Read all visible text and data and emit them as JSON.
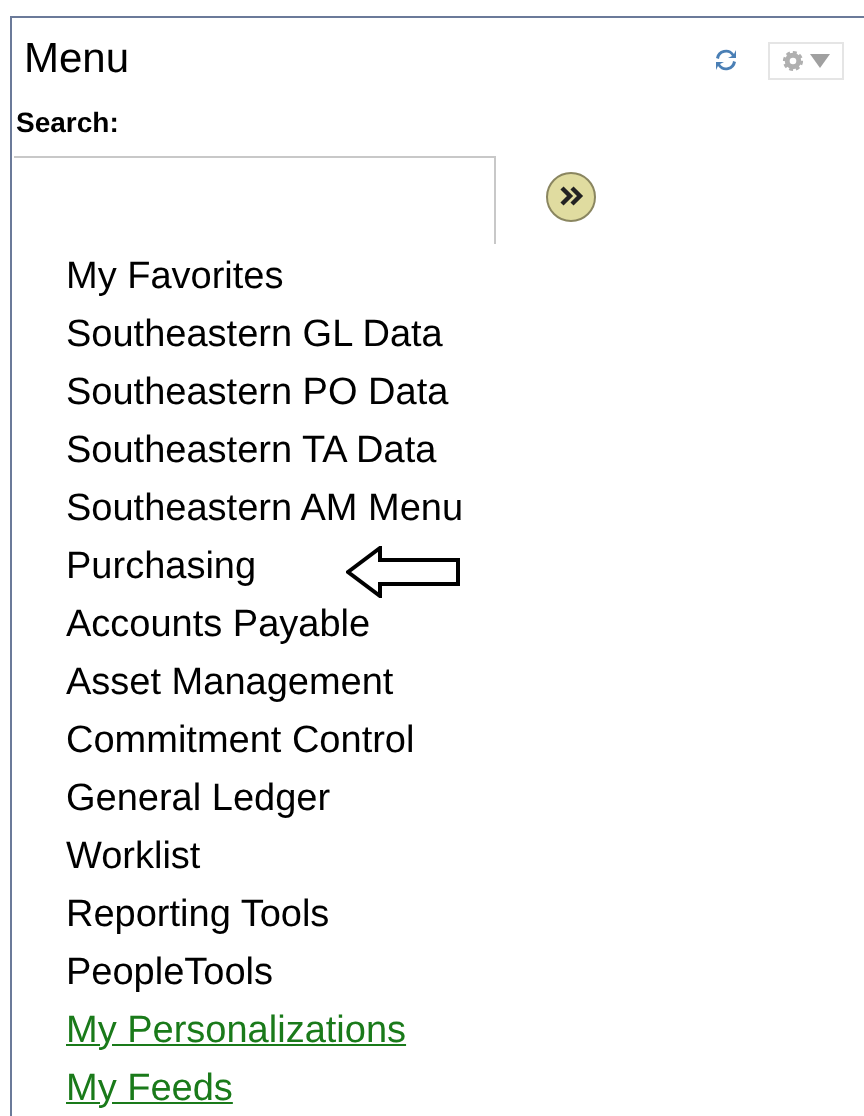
{
  "panel": {
    "title": "Menu"
  },
  "search": {
    "label": "Search:"
  },
  "items": [
    {
      "label": "My Favorites",
      "kind": "folder"
    },
    {
      "label": "Southeastern GL Data",
      "kind": "folder"
    },
    {
      "label": "Southeastern PO Data",
      "kind": "folder"
    },
    {
      "label": "Southeastern TA Data",
      "kind": "folder"
    },
    {
      "label": "Southeastern AM Menu",
      "kind": "folder"
    },
    {
      "label": "Purchasing",
      "kind": "folder",
      "pointed": true
    },
    {
      "label": "Accounts Payable",
      "kind": "folder"
    },
    {
      "label": "Asset Management",
      "kind": "folder"
    },
    {
      "label": "Commitment Control",
      "kind": "folder"
    },
    {
      "label": "General Ledger",
      "kind": "folder"
    },
    {
      "label": "Worklist",
      "kind": "folder"
    },
    {
      "label": "Reporting Tools",
      "kind": "folder"
    },
    {
      "label": "PeopleTools",
      "kind": "folder"
    },
    {
      "label": "My Personalizations",
      "kind": "link"
    },
    {
      "label": "My Feeds",
      "kind": "link"
    }
  ]
}
